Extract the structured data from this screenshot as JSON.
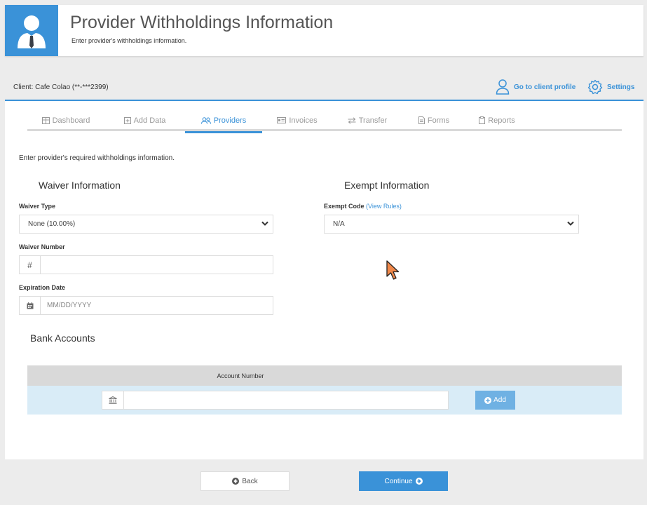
{
  "header": {
    "title": "Provider Withholdings Information",
    "subtitle": "Enter provider's withholdings information."
  },
  "client_bar": {
    "client_label": "Client: Cafe Colao (**-***2399)",
    "profile_link": "Go to client profile",
    "settings_link": "Settings"
  },
  "tabs": [
    {
      "label": "Dashboard",
      "icon": "table-icon",
      "active": false
    },
    {
      "label": "Add Data",
      "icon": "plus-square-icon",
      "active": false
    },
    {
      "label": "Providers",
      "icon": "users-icon",
      "active": true
    },
    {
      "label": "Invoices",
      "icon": "invoice-icon",
      "active": false
    },
    {
      "label": "Transfer",
      "icon": "exchange-icon",
      "active": false
    },
    {
      "label": "Forms",
      "icon": "file-icon",
      "active": false
    },
    {
      "label": "Reports",
      "icon": "clipboard-icon",
      "active": false
    }
  ],
  "intro": "Enter provider's required withholdings information.",
  "waiver": {
    "section_title": "Waiver Information",
    "type_label": "Waiver Type",
    "type_value": "None (10.00%)",
    "number_label": "Waiver Number",
    "number_addon": "#",
    "number_value": "",
    "expiration_label": "Expiration Date",
    "expiration_placeholder": "MM/DD/YYYY"
  },
  "exempt": {
    "section_title": "Exempt Information",
    "code_label": "Exempt Code",
    "view_rules": "(View Rules)",
    "code_value": "N/A"
  },
  "bank": {
    "section_title": "Bank Accounts",
    "column_header": "Account Number",
    "account_value": "",
    "add_label": "Add"
  },
  "footer": {
    "back_label": "Back",
    "continue_label": "Continue"
  },
  "colors": {
    "accent": "#3a92d8",
    "add_button": "#6fb1e3",
    "row_highlight": "#d9ecf7"
  }
}
